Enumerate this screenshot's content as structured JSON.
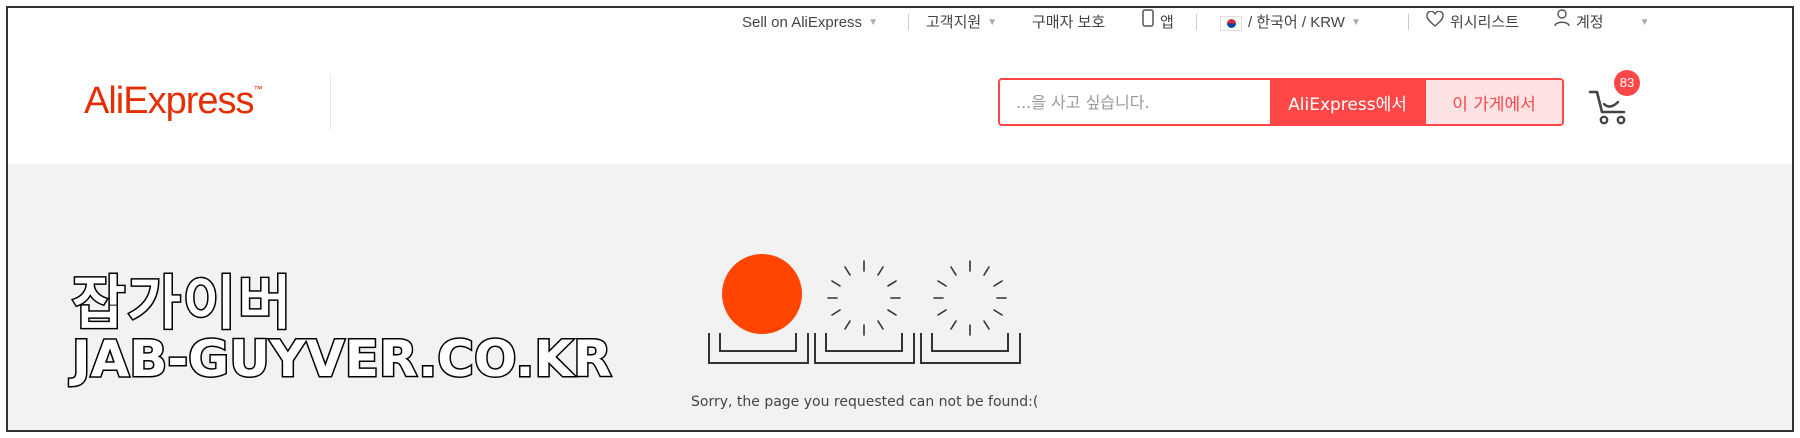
{
  "topbar": {
    "sell": "Sell on AliExpress",
    "support": "고객지원",
    "protection": "구매자 보호",
    "app": "앱",
    "locale": "/ 한국어 / KRW",
    "wishlist": "위시리스트",
    "account": "계정"
  },
  "header": {
    "logo": "AliExpress",
    "logo_tm": "™",
    "search_placeholder": "...을 사고 싶습니다.",
    "search_all": "AliExpress에서",
    "search_store": "이 가게에서",
    "cart_count": "83"
  },
  "watermark": {
    "title": "잡가이버",
    "url": "JAB-GUYVER.CO.KR"
  },
  "error": {
    "message": "Sorry, the page you requested can not be found:("
  },
  "colors": {
    "accent": "#ff4747",
    "logo": "#e62e04",
    "loader_dot": "#ff4500"
  }
}
